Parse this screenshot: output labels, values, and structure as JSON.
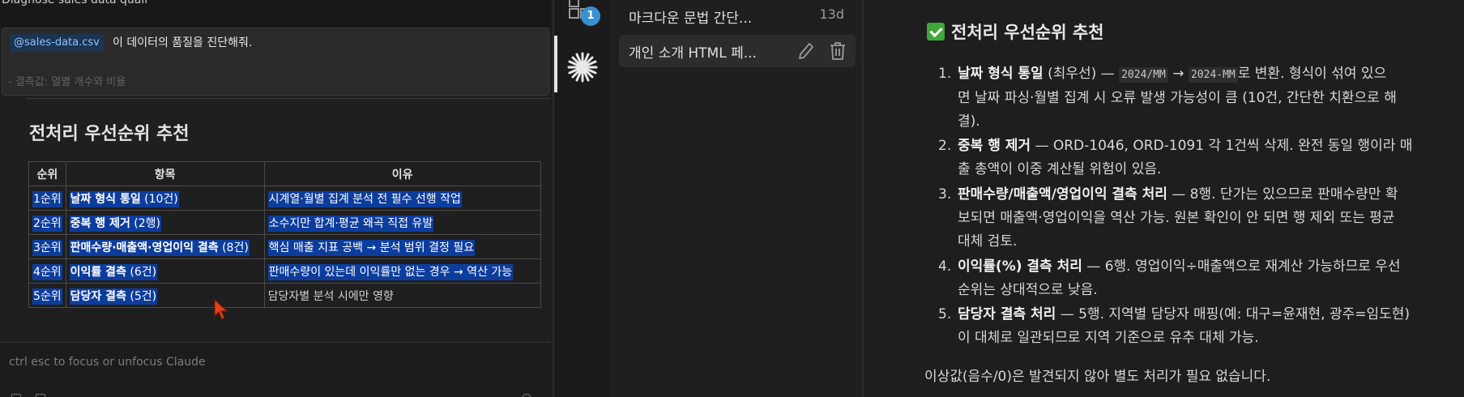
{
  "left": {
    "top_title": "Diagnose sales data quali",
    "prompt": {
      "file_chip": "@sales-data.csv",
      "text": "이 데이터의 품질을 진단해줘.",
      "faded_line": "- 결측값: 열별 개수와 비율"
    },
    "heading": "전처리 우선순위 추천",
    "table": {
      "headers": [
        "순위",
        "항목",
        "이유"
      ],
      "rows": [
        {
          "rank": "1순위",
          "item_bold": "날짜 형식 통일",
          "item_count": " (10건)",
          "reason": "시계열·월별 집계 분석 전 필수 선행 작업",
          "selected": true
        },
        {
          "rank": "2순위",
          "item_bold": "중복 행 제거",
          "item_count": " (2행)",
          "reason": "소수지만 합계·평균 왜곡 직접 유발",
          "selected": true
        },
        {
          "rank": "3순위",
          "item_bold": "판매수량·매출액·영업이익 결측",
          "item_count": " (8건)",
          "reason": "핵심 매출 지표 공백 → 분석 범위 결정 필요",
          "selected": true
        },
        {
          "rank": "4순위",
          "item_bold": "이익률 결측",
          "item_count": " (6건)",
          "reason": "판매수량이 있는데 이익률만 없는 경우 → 역산 가능",
          "selected": true
        },
        {
          "rank": "5순위",
          "item_bold": "담당자 결측",
          "item_count": " (5건)",
          "reason": "담당자별 분석 시에만 영향",
          "selected": false
        }
      ]
    },
    "hint": "ctrl esc to focus or unfocus Claude"
  },
  "activity": {
    "badge_count": "1"
  },
  "history": {
    "items": [
      {
        "title": "마크다운 문법 간단...",
        "age": "13d"
      },
      {
        "title": "개인 소개 HTML 페..."
      }
    ]
  },
  "doc": {
    "heading": "전처리 우선순위 추천",
    "items": [
      {
        "num": "1.",
        "bold": "날짜 형식 통일",
        "after_bold": " (최우선) — ",
        "code1": "2024/MM",
        "arrow": " → ",
        "code2": "2024-MM",
        "line1_end": "로 변환. 형식이 섞여 있으",
        "line2": "면 날짜 파싱·월별 집계 시 오류 발생 가능성이 큼 (10건, 간단한 치환으로 해",
        "line3": "결)."
      },
      {
        "num": "2.",
        "bold": "중복 행 제거",
        "line1_end": " — ORD-1046, ORD-1091 각 1건씩 삭제. 완전 동일 행이라 매",
        "line2": "출 총액이 이중 계산될 위험이 있음."
      },
      {
        "num": "3.",
        "bold": "판매수량/매출액/영업이익 결측 처리",
        "line1_end": " — 8행. 단가는 있으므로 판매수량만 확",
        "line2": "보되면 매출액·영업이익을 역산 가능. 원본 확인이 안 되면 행 제외 또는 평균",
        "line3": "대체 검토."
      },
      {
        "num": "4.",
        "bold": "이익률(%) 결측 처리",
        "line1_end": " — 6행. 영업이익÷매출액으로 재계산 가능하므로 우선",
        "line2": "순위는 상대적으로 낮음."
      },
      {
        "num": "5.",
        "bold": "담당자 결측 처리",
        "line1_end": " — 5행. 지역별 담당자 매핑(예: 대구=윤재현, 광주=임도현)",
        "line2": "이 대체로 일관되므로 지역 기준으로 유추 대체 가능."
      }
    ],
    "note": "이상값(음수/0)은 발견되지 않아 별도 처리가 필요 없습니다."
  },
  "colors": {
    "selection": "#0d3d9c",
    "badge": "#3790d0",
    "check": "#3fa63b",
    "cursor": "#e8401c"
  }
}
